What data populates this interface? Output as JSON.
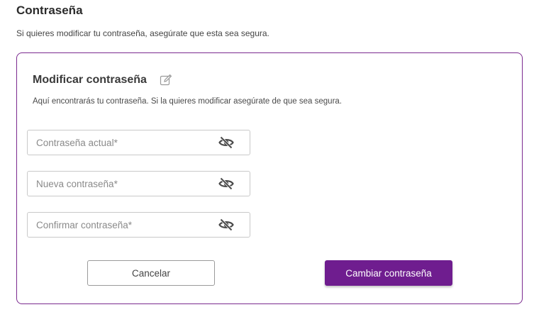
{
  "section": {
    "title": "Contraseña",
    "subtitle": "Si quieres modificar tu contraseña, asegúrate que esta sea segura."
  },
  "card": {
    "title": "Modificar contraseña",
    "description": "Aquí encontrarás tu contraseña. Si la quieres modificar asegúrate de que sea segura.",
    "edit_icon": "edit-icon",
    "fields": [
      {
        "placeholder": "Contraseña actual*",
        "value": "",
        "icon": "eye-slash-icon"
      },
      {
        "placeholder": "Nueva contraseña*",
        "value": "",
        "icon": "eye-slash-icon"
      },
      {
        "placeholder": "Confirmar contraseña*",
        "value": "",
        "icon": "eye-slash-icon"
      }
    ],
    "buttons": {
      "cancel_label": "Cancelar",
      "submit_label": "Cambiar contraseña"
    }
  },
  "colors": {
    "accent": "#6f1d8f",
    "card_border": "#7b2a8f"
  }
}
